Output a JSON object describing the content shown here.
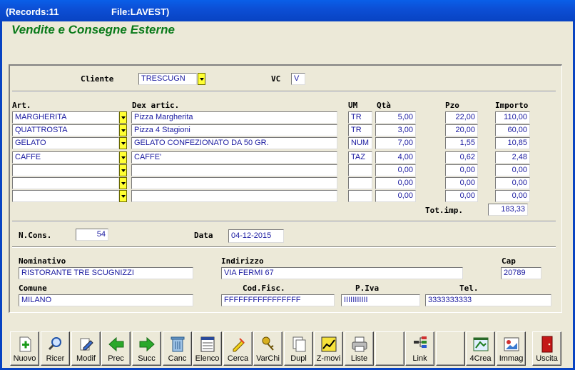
{
  "titlebar": {
    "records": "(Records:11",
    "file": "File:LAVEST)"
  },
  "form_title": "Vendite e Consegne Esterne",
  "header": {
    "cliente_label": "Cliente",
    "cliente_value": "TRESCUGN",
    "vc_label": "VC",
    "vc_value": "V"
  },
  "grid": {
    "headers": {
      "art": "Art.",
      "dex": "Dex artic.",
      "um": "UM",
      "qta": "Qtà",
      "pzo": "Pzo",
      "importo": "Importo"
    },
    "rows": [
      {
        "art": "MARGHERITA",
        "dex": "Pizza Margherita",
        "um": "TR",
        "qta": "5,00",
        "pzo": "22,00",
        "importo": "110,00"
      },
      {
        "art": "QUATTROSTA",
        "dex": "Pizza 4 Stagioni",
        "um": "TR",
        "qta": "3,00",
        "pzo": "20,00",
        "importo": "60,00"
      },
      {
        "art": "GELATO",
        "dex": "GELATO CONFEZIONATO DA 50 GR.",
        "um": "NUM",
        "qta": "7,00",
        "pzo": "1,55",
        "importo": "10,85"
      },
      {
        "art": "CAFFE",
        "dex": "CAFFE'",
        "um": "TAZ",
        "qta": "4,00",
        "pzo": "0,62",
        "importo": "2,48"
      },
      {
        "art": "",
        "dex": "",
        "um": "",
        "qta": "0,00",
        "pzo": "0,00",
        "importo": "0,00"
      },
      {
        "art": "",
        "dex": "",
        "um": "",
        "qta": "0,00",
        "pzo": "0,00",
        "importo": "0,00"
      },
      {
        "art": "",
        "dex": "",
        "um": "",
        "qta": "0,00",
        "pzo": "0,00",
        "importo": "0,00"
      }
    ],
    "total_label": "Tot.imp.",
    "total_value": "183,33"
  },
  "consegna": {
    "ncons_label": "N.Cons.",
    "ncons_value": "54",
    "data_label": "Data",
    "data_value": "04-12-2015"
  },
  "anagrafica": {
    "nominativo_label": "Nominativo",
    "nominativo_value": "RISTORANTE TRE SCUGNIZZI",
    "indirizzo_label": "Indirizzo",
    "indirizzo_value": "VIA FERMI 67",
    "cap_label": "Cap",
    "cap_value": "20789",
    "comune_label": "Comune",
    "comune_value": "MILANO",
    "codfisc_label": "Cod.Fisc.",
    "codfisc_value": "FFFFFFFFFFFFFFFF",
    "piva_label": "P.Iva",
    "piva_value": "IIIIIIIIIII",
    "tel_label": "Tel.",
    "tel_value": "3333333333"
  },
  "toolbar": [
    {
      "label": "Nuovo",
      "icon": "new-doc-icon"
    },
    {
      "label": "Ricer",
      "icon": "search-icon"
    },
    {
      "label": "Modif",
      "icon": "edit-icon"
    },
    {
      "label": "Prec",
      "icon": "arrow-left-icon"
    },
    {
      "label": "Succ",
      "icon": "arrow-right-icon"
    },
    {
      "label": "Canc",
      "icon": "trash-icon"
    },
    {
      "label": "Elenco",
      "icon": "list-icon"
    },
    {
      "label": "Cerca",
      "icon": "highlighter-icon"
    },
    {
      "label": "VarChi",
      "icon": "keys-icon"
    },
    {
      "label": "Dupl",
      "icon": "duplicate-icon"
    },
    {
      "label": "Z-movi",
      "icon": "chart-icon"
    },
    {
      "label": "Liste",
      "icon": "printer-icon"
    },
    {
      "label": "",
      "icon": ""
    },
    {
      "label": "Link",
      "icon": "link-tree-icon"
    },
    {
      "label": "",
      "icon": ""
    },
    {
      "label": "4Crea",
      "icon": "create-icon"
    },
    {
      "label": "Immag",
      "icon": "image-icon"
    },
    {
      "label": "",
      "icon": ""
    },
    {
      "label": "Uscita",
      "icon": "exit-door-icon"
    }
  ],
  "colors": {
    "title_green": "#0a7a1a",
    "field_text": "#1a1aa0",
    "dropdown_yellow": "#ffff33",
    "titlebar_blue": "#0a5fe8"
  }
}
